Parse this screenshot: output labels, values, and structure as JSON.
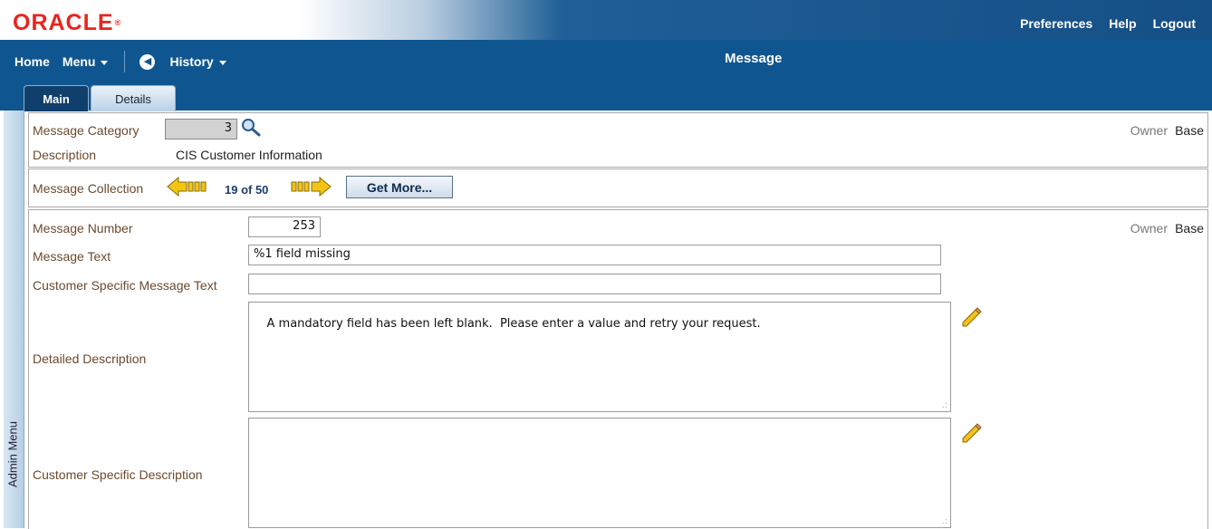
{
  "header": {
    "logo": "ORACLE",
    "links": {
      "preferences": "Preferences",
      "help": "Help",
      "logout": "Logout"
    }
  },
  "nav": {
    "home": "Home",
    "menu": "Menu",
    "history": "History",
    "page_title": "Message",
    "tabs": {
      "main": "Main",
      "details": "Details"
    }
  },
  "sidebar": {
    "admin_menu": "Admin Menu"
  },
  "category_section": {
    "message_category_label": "Message Category",
    "message_category_value": "3",
    "description_label": "Description",
    "description_value": "CIS Customer Information",
    "owner_label": "Owner",
    "owner_value": "Base"
  },
  "collection_section": {
    "label": "Message Collection",
    "position": "19 of 50",
    "get_more": "Get More..."
  },
  "message_section": {
    "message_number_label": "Message Number",
    "message_number_value": "253",
    "owner_label": "Owner",
    "owner_value": "Base",
    "message_text_label": "Message Text",
    "message_text_value": "%1 field missing",
    "customer_message_text_label": "Customer Specific Message Text",
    "customer_message_text_value": "",
    "detailed_description_label": "Detailed Description",
    "detailed_description_value": "A mandatory field has been left blank.  Please enter a value and retry your request.",
    "customer_description_label": "Customer Specific Description",
    "customer_description_value": ""
  },
  "colors": {
    "header_blue": "#0f5690",
    "logo_red": "#e8251f",
    "label_brown": "#6b4a2e"
  }
}
